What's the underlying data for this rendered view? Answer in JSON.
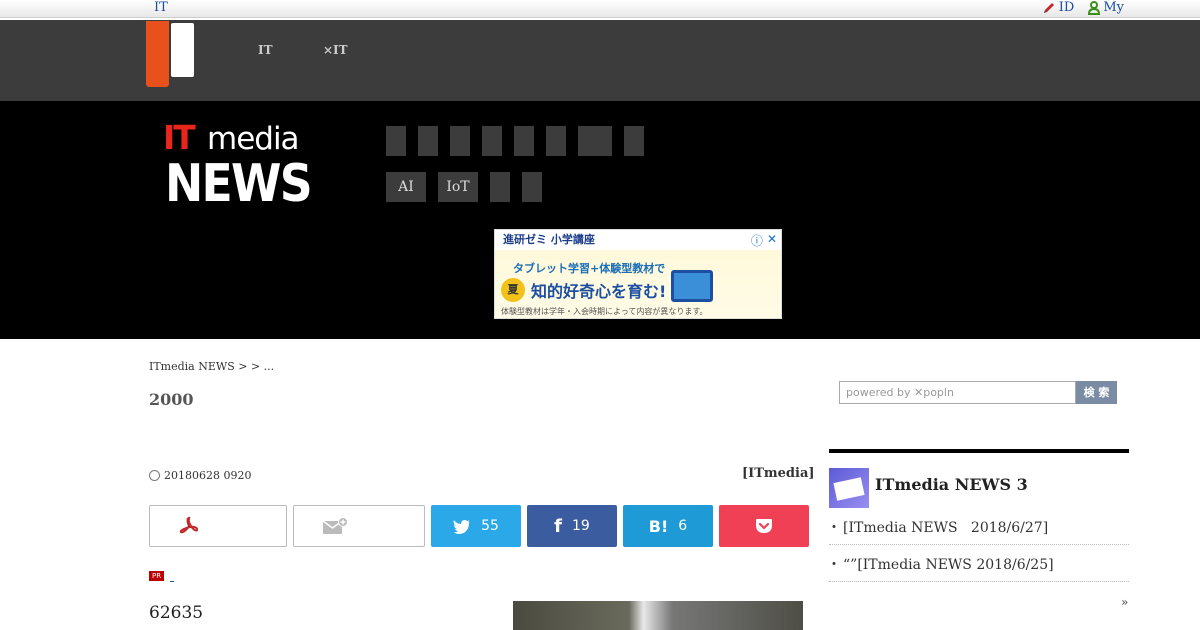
{
  "topbar": {
    "it_link": "IT",
    "id_label": "ID",
    "my_label": "My"
  },
  "header_nav": [
    {
      "line1": "​​",
      "line2": "IT"
    },
    {
      "line1": "​​​",
      "line2": "×IT"
    }
  ],
  "brand": {
    "it": "IT",
    "media": "media",
    "news": "NEWS"
  },
  "categories_row1": [
    "",
    "",
    "",
    "",
    "",
    "",
    "",
    ""
  ],
  "categories_row2": [
    "AI",
    "IoT",
    "",
    ""
  ],
  "ad": {
    "head": "進研ゼミ 小学講座",
    "line1": "タブレット学習+体験型教材で",
    "summer": "夏",
    "main": "知的好奇心を育む!",
    "foot": "体験型教材は学年・入会時期によって内容が異なります。"
  },
  "breadcrumb": "ITmedia NEWS > > ...",
  "article": {
    "title": "2000",
    "date": "20180628 0920",
    "source": "[ITmedia]",
    "views": "62635"
  },
  "share": {
    "twitter_count": "55",
    "facebook_count": "19",
    "hatena_count": "6"
  },
  "pr_tag": "PR",
  "search": {
    "placeholder": "powered by ✕popln",
    "button": "検 索"
  },
  "ranking": {
    "title": "ITmedia NEWS 3",
    "items": [
      "[ITmedia NEWS   2018/6/27]",
      "“”[ITmedia NEWS 2018/6/25]"
    ],
    "more": "»"
  }
}
